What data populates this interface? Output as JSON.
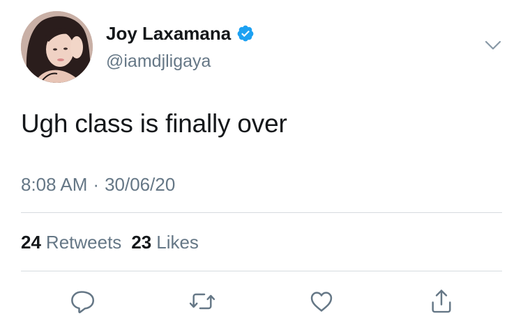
{
  "tweet": {
    "author": {
      "display_name": "Joy Laxamana",
      "handle": "@iamdjligaya",
      "verified": true,
      "avatar_icon": "profile-photo"
    },
    "text": "Ugh class is finally over",
    "time": "8:08 AM",
    "separator": "·",
    "date": "30/06/20",
    "stats": {
      "retweets_count": "24",
      "retweets_label": "Retweets",
      "likes_count": "23",
      "likes_label": "Likes"
    },
    "actions": [
      {
        "icon": "reply-icon"
      },
      {
        "icon": "retweet-icon"
      },
      {
        "icon": "like-icon"
      },
      {
        "icon": "share-icon"
      }
    ]
  },
  "colors": {
    "text_primary": "#14171a",
    "text_secondary": "#657786",
    "verified_blue": "#1da1f2",
    "divider": "#d6dbdf"
  }
}
